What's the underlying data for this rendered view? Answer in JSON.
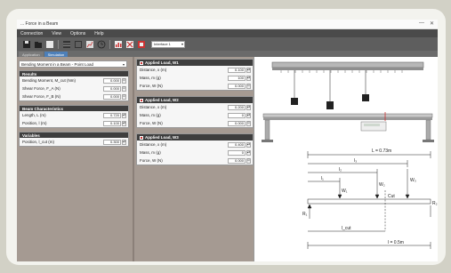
{
  "window": {
    "title": "Bending Moment in a Beam",
    "title_visible": "... Force in a Beam",
    "minimize": "—",
    "close": "✕"
  },
  "menu": [
    "Connection",
    "View",
    "Options",
    "Help"
  ],
  "toolbar": {
    "select_value": "Interface 1"
  },
  "tabs": [
    "Application",
    "Simulation"
  ],
  "left": {
    "experiment_select": "Bending Moment in a Beam - Point Load",
    "groups": [
      {
        "header": "Results",
        "rows": [
          {
            "label": "Bending Moment, M_cut (Nm)",
            "value": "0.000"
          },
          {
            "label": "Shear Force, F_A (N)",
            "value": "0.000"
          },
          {
            "label": "Shear Force, F_B (N)",
            "value": "0.000"
          }
        ]
      },
      {
        "header": "Beam Characteristics",
        "rows": [
          {
            "label": "Length, L (m)",
            "value": "0.720"
          },
          {
            "label": "Position, l (m)",
            "value": "0.100"
          }
        ]
      },
      {
        "header": "Variables",
        "rows": [
          {
            "label": "Position, l_cut (m)",
            "value": "0.300"
          }
        ]
      }
    ]
  },
  "loads": [
    {
      "header": "Applied Load, W1",
      "rows": [
        {
          "label": "Distance, x (m)",
          "value": "0.100"
        },
        {
          "label": "Mass, m (g)",
          "value": "100"
        },
        {
          "label": "Force, W (N)",
          "value": "0.000"
        }
      ]
    },
    {
      "header": "Applied Load, W2",
      "rows": [
        {
          "label": "Distance, x (m)",
          "value": "0.200"
        },
        {
          "label": "Mass, m (g)",
          "value": "0"
        },
        {
          "label": "Force, W (N)",
          "value": "0.000"
        }
      ]
    },
    {
      "header": "Applied Load, W3",
      "rows": [
        {
          "label": "Distance, x (m)",
          "value": "0.400"
        },
        {
          "label": "Mass, m (g)",
          "value": "0"
        },
        {
          "label": "Force, W (N)",
          "value": "0.000"
        }
      ]
    }
  ],
  "diagram": {
    "L_label": "L = 0.73m",
    "l_label": "l = 0.5m",
    "cut_label": "Cut",
    "labels": [
      "l₃",
      "l₂",
      "l₁",
      "W₃",
      "W₂",
      "W₁",
      "R₁",
      "R₂",
      "l_cut"
    ]
  },
  "colors": {
    "panel_bg": "#a59a92",
    "header_dark": "#3e3e3e",
    "accent_red": "#cc3333",
    "tab_active": "#4d7fb8"
  }
}
